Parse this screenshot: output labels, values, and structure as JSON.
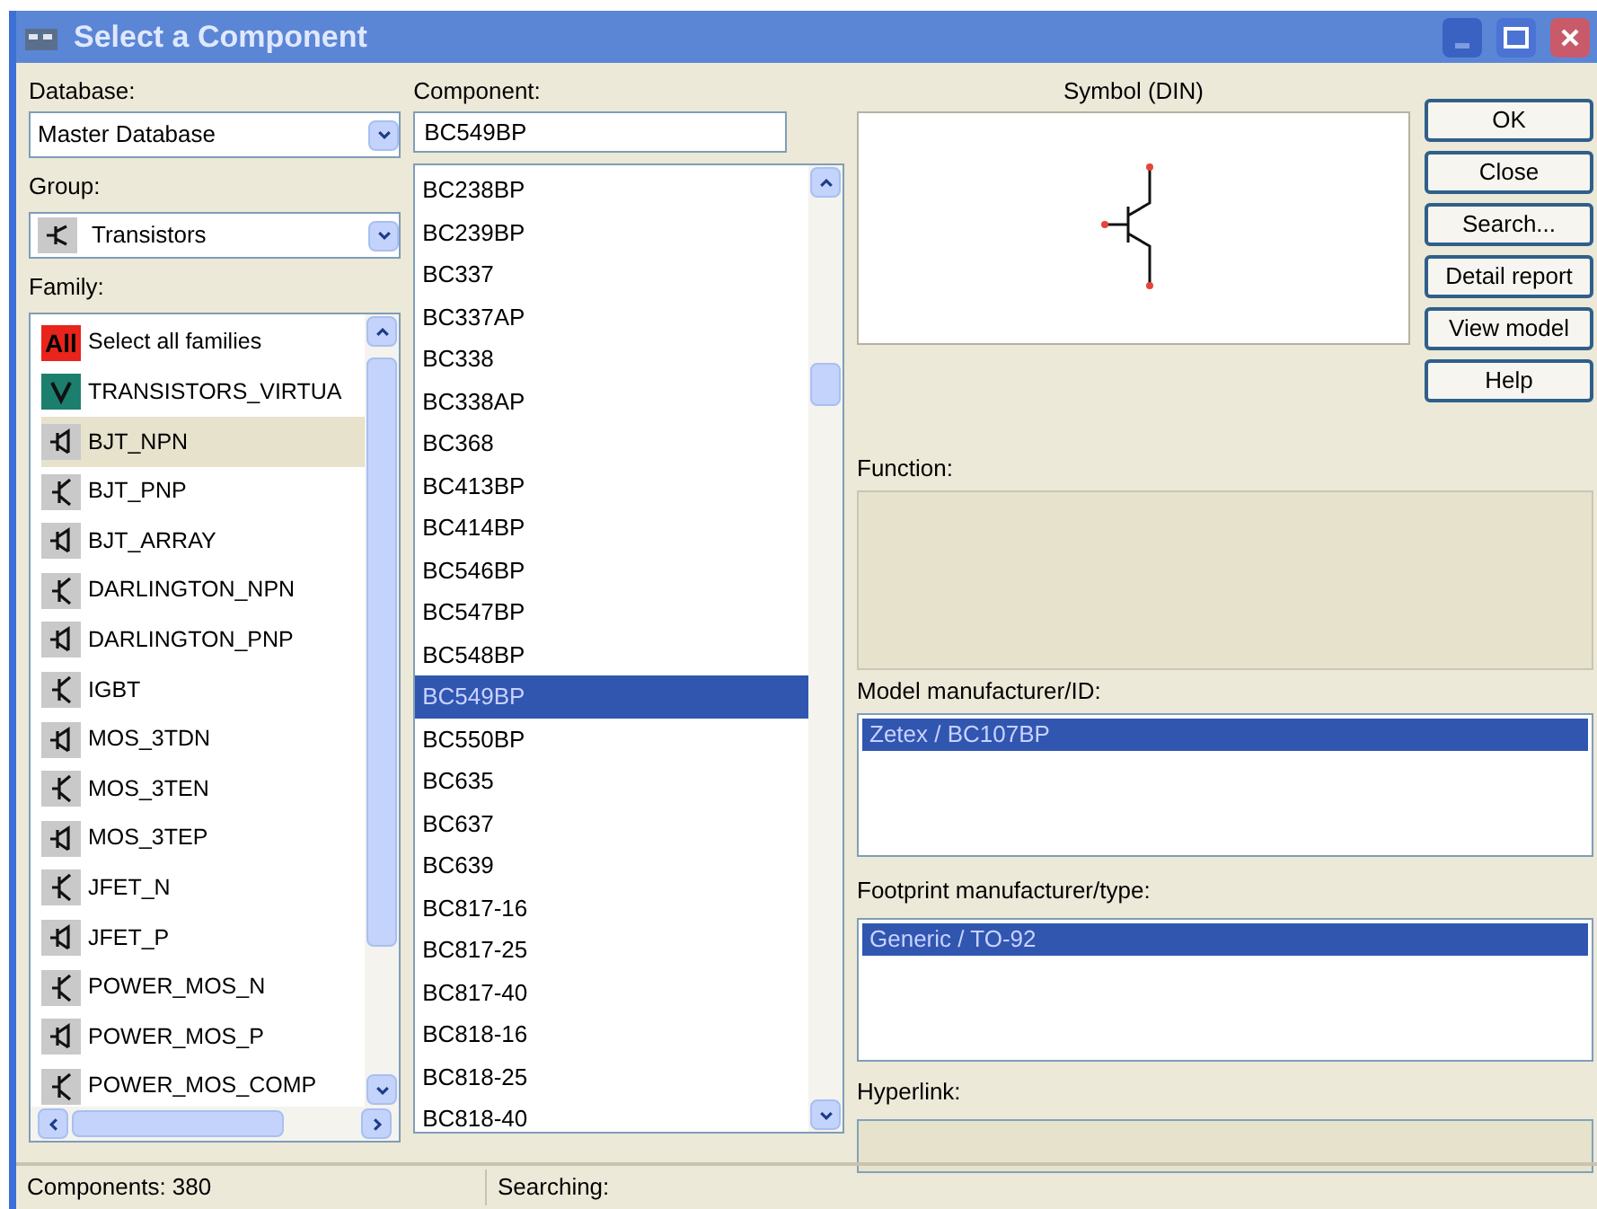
{
  "window": {
    "title": "Select a Component"
  },
  "database": {
    "label": "Database:",
    "value": "Master Database"
  },
  "group": {
    "label": "Group:",
    "value": "Transistors"
  },
  "family": {
    "label": "Family:",
    "items": [
      {
        "label": "Select all families",
        "kind": "all",
        "badge": "All",
        "selected": false
      },
      {
        "label": "TRANSISTORS_VIRTUA",
        "kind": "virtual",
        "selected": false
      },
      {
        "label": "BJT_NPN",
        "kind": "symbol",
        "selected": true
      },
      {
        "label": "BJT_PNP",
        "kind": "symbol",
        "selected": false
      },
      {
        "label": "BJT_ARRAY",
        "kind": "symbol",
        "selected": false
      },
      {
        "label": "DARLINGTON_NPN",
        "kind": "symbol",
        "selected": false
      },
      {
        "label": "DARLINGTON_PNP",
        "kind": "symbol",
        "selected": false
      },
      {
        "label": "IGBT",
        "kind": "symbol",
        "selected": false
      },
      {
        "label": "MOS_3TDN",
        "kind": "symbol",
        "selected": false
      },
      {
        "label": "MOS_3TEN",
        "kind": "symbol",
        "selected": false
      },
      {
        "label": "MOS_3TEP",
        "kind": "symbol",
        "selected": false
      },
      {
        "label": "JFET_N",
        "kind": "symbol",
        "selected": false
      },
      {
        "label": "JFET_P",
        "kind": "symbol",
        "selected": false
      },
      {
        "label": "POWER_MOS_N",
        "kind": "symbol",
        "selected": false
      },
      {
        "label": "POWER_MOS_P",
        "kind": "symbol",
        "selected": false
      },
      {
        "label": "POWER_MOS_COMP",
        "kind": "symbol",
        "selected": false
      }
    ]
  },
  "component": {
    "label": "Component:",
    "value": "BC549BP",
    "items": [
      {
        "label": "BC238BP",
        "selected": false
      },
      {
        "label": "BC239BP",
        "selected": false
      },
      {
        "label": "BC337",
        "selected": false
      },
      {
        "label": "BC337AP",
        "selected": false
      },
      {
        "label": "BC338",
        "selected": false
      },
      {
        "label": "BC338AP",
        "selected": false
      },
      {
        "label": "BC368",
        "selected": false
      },
      {
        "label": "BC413BP",
        "selected": false
      },
      {
        "label": "BC414BP",
        "selected": false
      },
      {
        "label": "BC546BP",
        "selected": false
      },
      {
        "label": "BC547BP",
        "selected": false
      },
      {
        "label": "BC548BP",
        "selected": false
      },
      {
        "label": "BC549BP",
        "selected": true
      },
      {
        "label": "BC550BP",
        "selected": false
      },
      {
        "label": "BC635",
        "selected": false
      },
      {
        "label": "BC637",
        "selected": false
      },
      {
        "label": "BC639",
        "selected": false
      },
      {
        "label": "BC817-16",
        "selected": false
      },
      {
        "label": "BC817-25",
        "selected": false
      },
      {
        "label": "BC817-40",
        "selected": false
      },
      {
        "label": "BC818-16",
        "selected": false
      },
      {
        "label": "BC818-25",
        "selected": false
      },
      {
        "label": "BC818-40",
        "selected": false
      }
    ]
  },
  "symbol": {
    "label": "Symbol (DIN)"
  },
  "buttons": [
    "OK",
    "Close",
    "Search...",
    "Detail report",
    "View model",
    "Help"
  ],
  "function": {
    "label": "Function:"
  },
  "model": {
    "label": "Model manufacturer/ID:",
    "items": [
      {
        "label": "Zetex / BC107BP",
        "selected": true
      }
    ]
  },
  "footprint": {
    "label": "Footprint manufacturer/type:",
    "items": [
      {
        "label": "Generic / TO-92",
        "selected": true
      }
    ]
  },
  "hyperlink": {
    "label": "Hyperlink:"
  },
  "status_bar": {
    "components": "Components: 380",
    "searching": "Searching:"
  }
}
